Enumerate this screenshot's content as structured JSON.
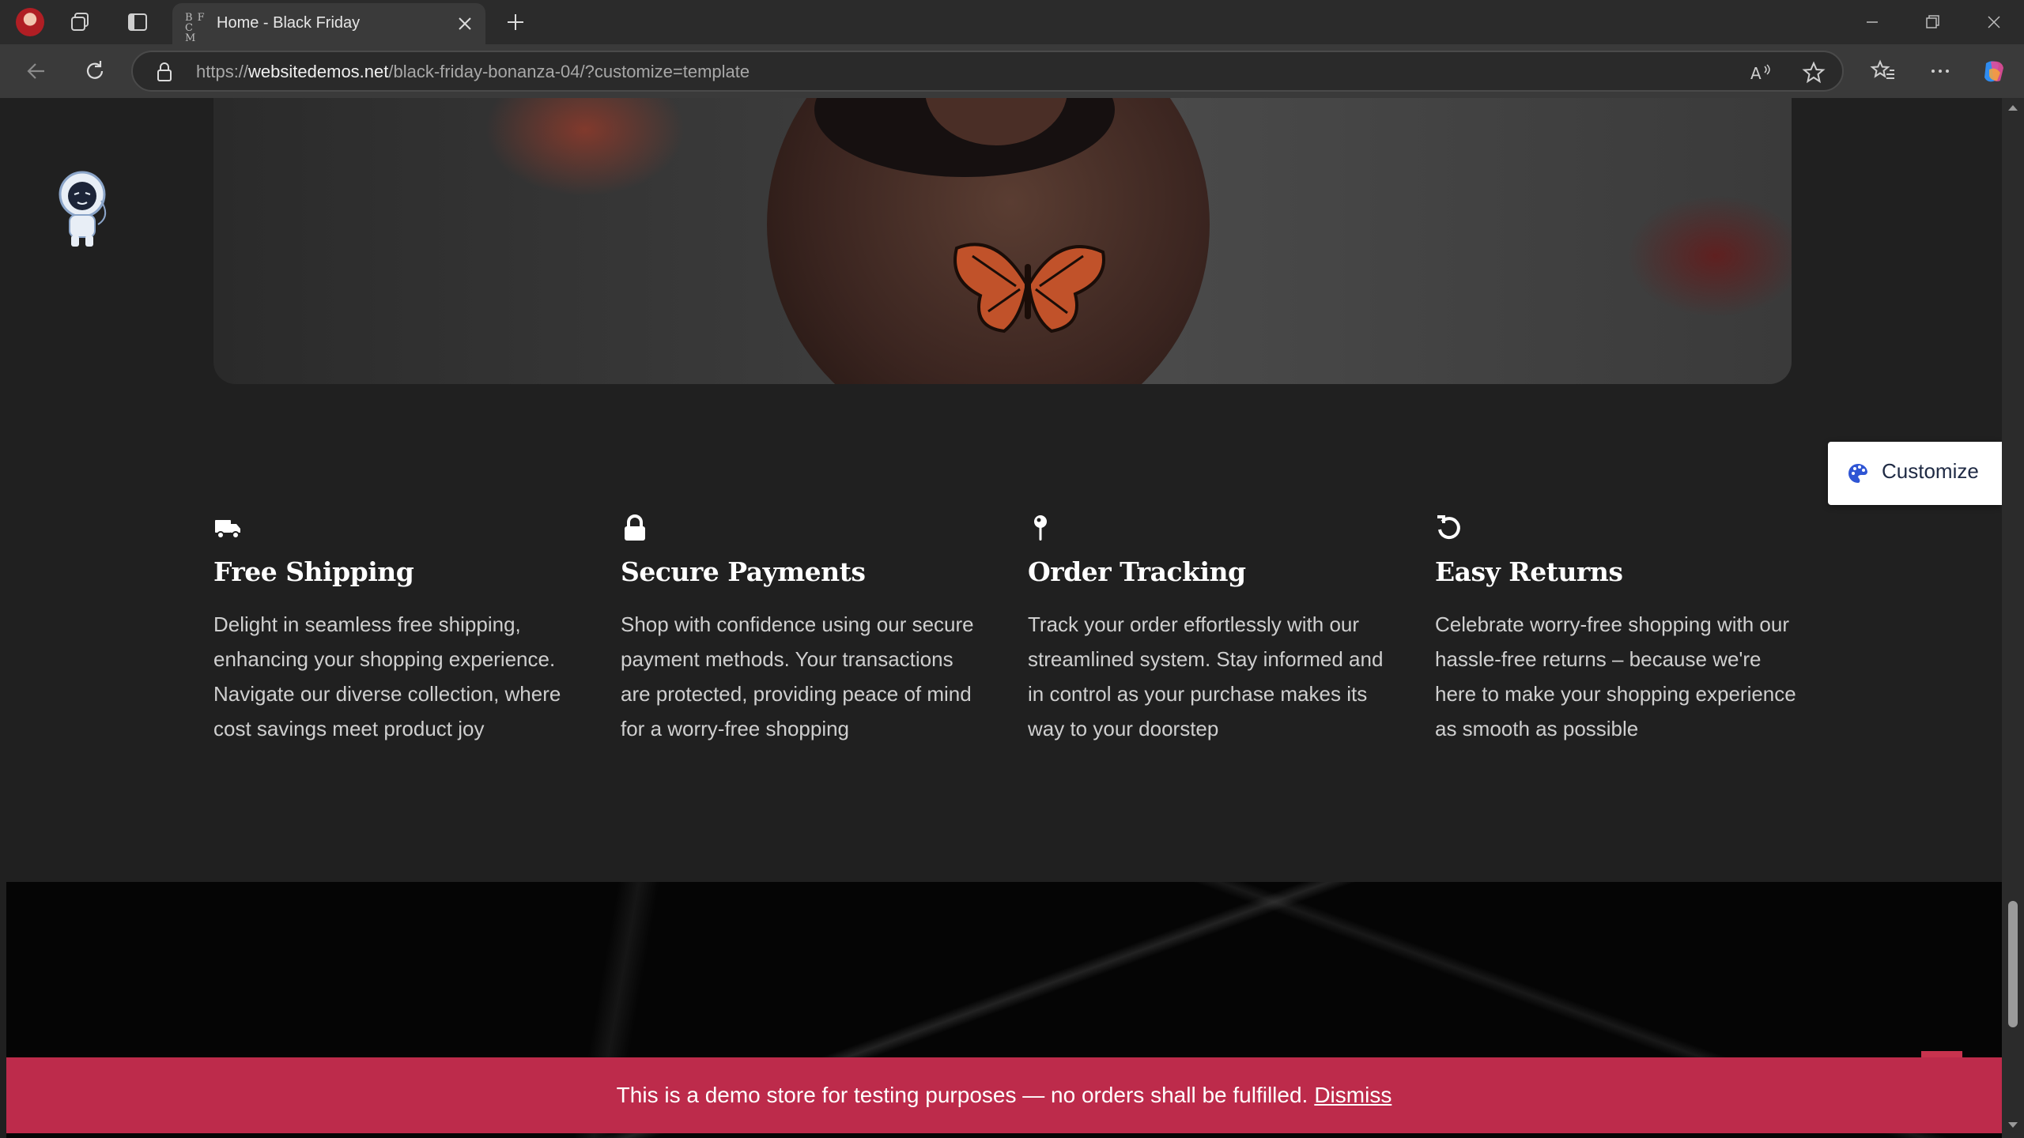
{
  "browser": {
    "tab_title": "Home - Black Friday",
    "favicon_text": "B F C M",
    "url_prefix": "https://",
    "url_domain": "websitedemos.net",
    "url_path": "/black-friday-bonanza-04/?customize=template",
    "icons": [
      "profile-icon",
      "workspaces-icon",
      "tab-actions-icon",
      "close-icon",
      "new-tab-icon",
      "minimize-icon",
      "restore-icon",
      "window-close-icon",
      "back-icon",
      "refresh-icon",
      "lock-icon",
      "read-aloud-icon",
      "favorite-icon",
      "favorites-icon",
      "more-icon",
      "copilot-icon"
    ]
  },
  "features": [
    {
      "icon": "truck-icon",
      "title": "Free Shipping",
      "text": "Delight in seamless free shipping, enhancing your shopping experience. Navigate our diverse collection, where cost savings meet product joy"
    },
    {
      "icon": "lock-icon",
      "title": "Secure Payments",
      "text": "Shop with confidence using our secure payment methods. Your transactions are protected, providing peace of mind for a worry-free shopping"
    },
    {
      "icon": "map-pin-icon",
      "title": "Order Tracking",
      "text": "Track your order effortlessly with our streamlined system. Stay informed and in control as your purchase makes its way to your doorstep"
    },
    {
      "icon": "undo-icon",
      "title": "Easy Returns",
      "text": "Celebrate worry-free shopping with our hassle-free returns – because we're here to make your shopping experience as smooth as possible"
    }
  ],
  "customize": {
    "label": "Customize",
    "icon": "palette-icon"
  },
  "demo_notice": {
    "text": "This is a demo store for testing purposes — no orders shall be fulfilled.",
    "dismiss": "Dismiss"
  },
  "colors": {
    "page_bg": "#202020",
    "banner": "#bd2b4b",
    "customize_icon": "#2f55d4"
  }
}
